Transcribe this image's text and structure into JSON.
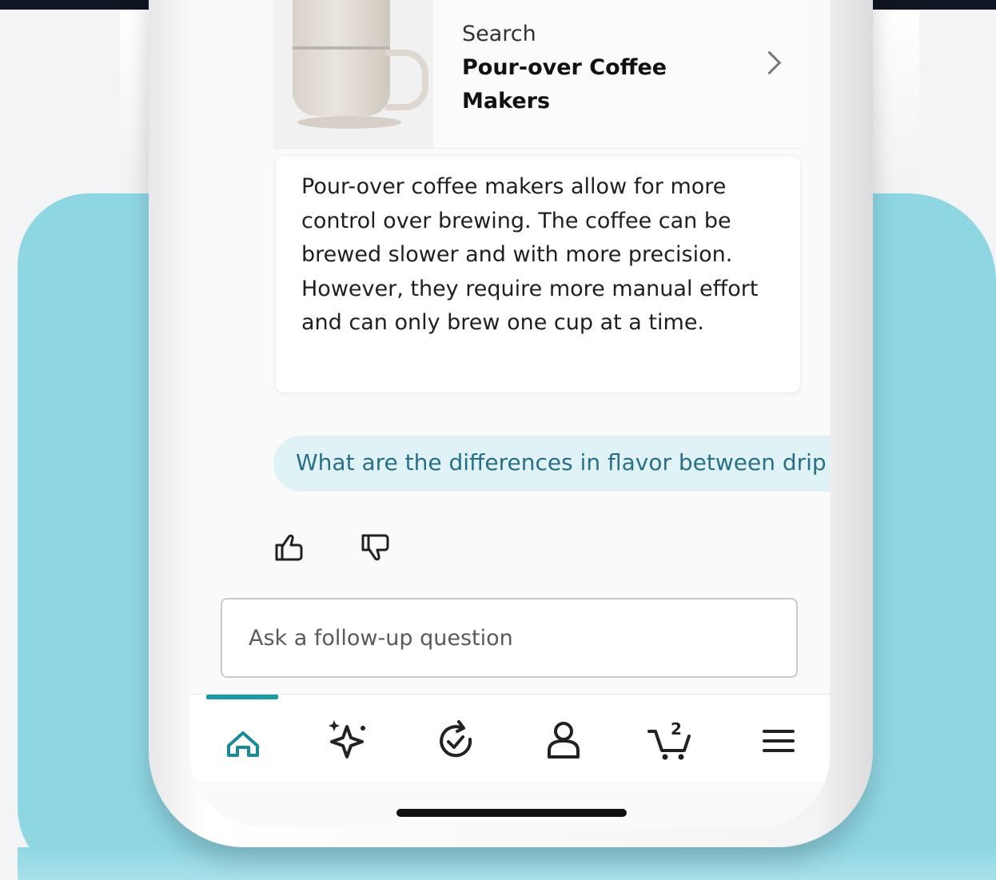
{
  "product_card": {
    "eyebrow": "Search",
    "title": "Pour-over Coffee Makers",
    "chevron_icon": "chevron-right-icon"
  },
  "answer": {
    "text": "Pour-over coffee makers allow for more control over brewing. The coffee can be brewed slower and with more precision. However, they require more manual effort and can only brew one cup at a time."
  },
  "suggestion": {
    "text": "What are the differences in flavor between drip"
  },
  "feedback": {
    "thumbs_up_icon": "thumbs-up-icon",
    "thumbs_down_icon": "thumbs-down-icon"
  },
  "follow_up": {
    "placeholder": "Ask a follow-up question",
    "value": ""
  },
  "bottom_nav": {
    "active": "home",
    "items": [
      {
        "id": "home",
        "icon": "home-icon"
      },
      {
        "id": "ai",
        "icon": "sparkle-icon"
      },
      {
        "id": "orders",
        "icon": "refresh-check-icon"
      },
      {
        "id": "account",
        "icon": "person-icon"
      },
      {
        "id": "cart",
        "icon": "cart-icon",
        "badge": "2"
      },
      {
        "id": "menu",
        "icon": "menu-icon"
      }
    ]
  },
  "colors": {
    "accent": "#1a9ca4",
    "chip_bg": "#dff3f6",
    "chip_text": "#2a6f86",
    "background_panel": "#8fd6e3"
  }
}
